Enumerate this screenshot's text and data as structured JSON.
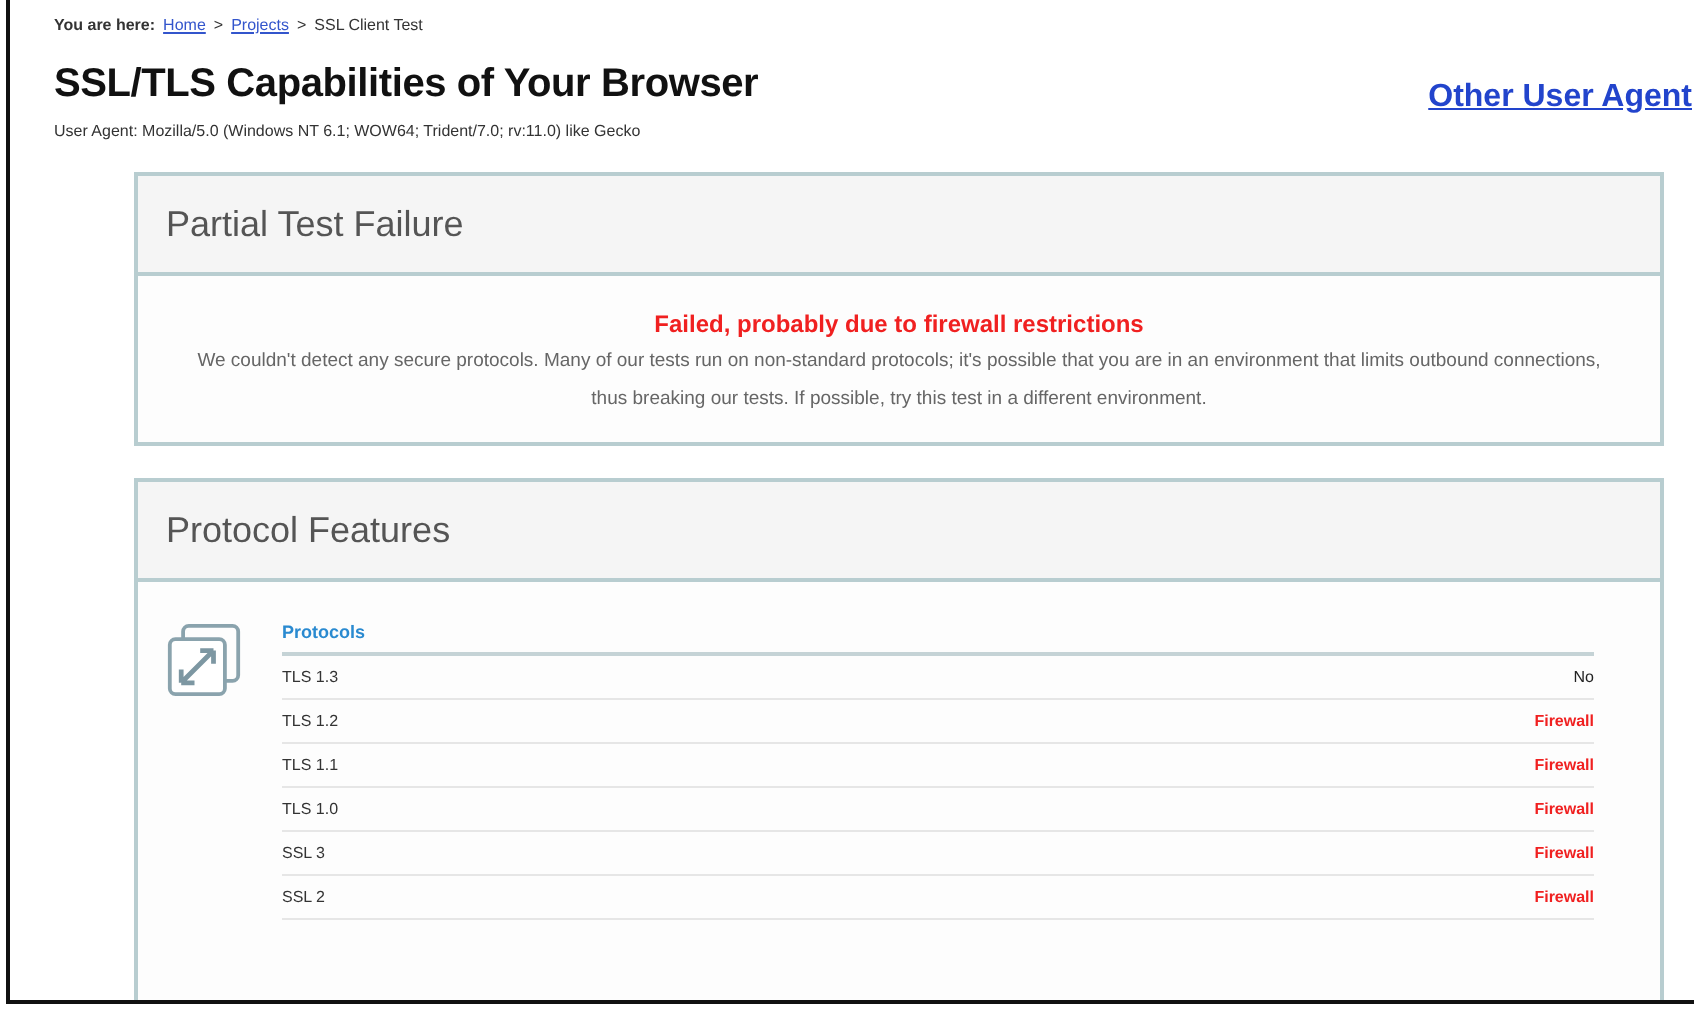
{
  "breadcrumb": {
    "label": "You are here:",
    "links": [
      "Home",
      "Projects"
    ],
    "separator": ">",
    "current": "SSL Client Test"
  },
  "title": "SSL/TLS Capabilities of Your Browser",
  "other_link": "Other User Agent",
  "user_agent": "User Agent: Mozilla/5.0 (Windows NT 6.1; WOW64; Trident/7.0; rv:11.0) like Gecko",
  "failure_card": {
    "title": "Partial Test Failure",
    "headline": "Failed, probably due to firewall restrictions",
    "message": "We couldn't detect any secure protocols. Many of our tests run on non-standard protocols; it's possible that you are in an environment that limits outbound connections, thus breaking our tests. If possible, try this test in a different environment."
  },
  "features_card": {
    "title": "Protocol Features",
    "section": "Protocols",
    "rows": [
      {
        "name": "TLS 1.3",
        "result": "No",
        "kind": "plain"
      },
      {
        "name": "TLS 1.2",
        "result": "Firewall",
        "kind": "alert"
      },
      {
        "name": "TLS 1.1",
        "result": "Firewall",
        "kind": "alert"
      },
      {
        "name": "TLS 1.0",
        "result": "Firewall",
        "kind": "alert"
      },
      {
        "name": "SSL 3",
        "result": "Firewall",
        "kind": "alert"
      },
      {
        "name": "SSL 2",
        "result": "Firewall",
        "kind": "alert"
      }
    ]
  }
}
